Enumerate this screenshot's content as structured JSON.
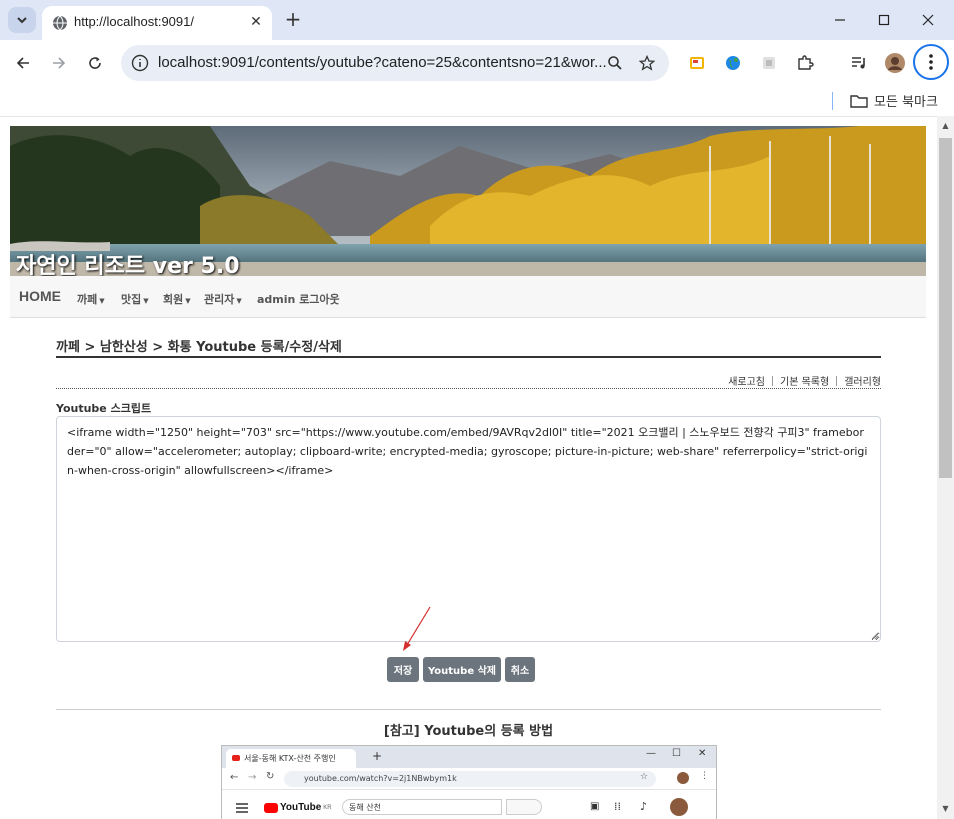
{
  "browser": {
    "tab_title": "http://localhost:9091/",
    "url": "localhost:9091/contents/youtube?cateno=25&contentsno=21&wor...",
    "bookmarks_folder": "모든 북마크",
    "accent_color": "#1a73e8"
  },
  "site": {
    "banner_title": "자연인 리조트 ver 5.0",
    "nav": {
      "home": "HOME",
      "items": [
        "까페",
        "맛집",
        "회원",
        "관리자",
        "admin 로그아웃"
      ]
    }
  },
  "page": {
    "breadcrumb": "까페 > 남한산성 > 화통 Youtube 등록/수정/삭제",
    "actions": [
      "새로고침",
      "기본 목록형",
      "갤러리형"
    ],
    "field_label": "Youtube 스크립트",
    "script_value": "<iframe width=\"1250\" height=\"703\" src=\"https://www.youtube.com/embed/9AVRqv2dl0I\" title=\"2021 오크밸리 | 스노우보드 전향각 구피3\" frameborder=\"0\" allow=\"accelerometer; autoplay; clipboard-write; encrypted-media; gyroscope; picture-in-picture; web-share\" referrerpolicy=\"strict-origin-when-cross-origin\" allowfullscreen></iframe>",
    "buttons": {
      "save": "저장",
      "delete": "Youtube 삭제",
      "cancel": "취소"
    },
    "reference_title": "[참고] Youtube의 등록 방법",
    "reference_shot": {
      "tab_title": "서울-동해 KTX-산천 주행인",
      "url": "youtube.com/watch?v=2j1NBwbym1k",
      "logo": "YouTube",
      "logo_sup": "KR",
      "search_value": "동해 산천"
    }
  }
}
